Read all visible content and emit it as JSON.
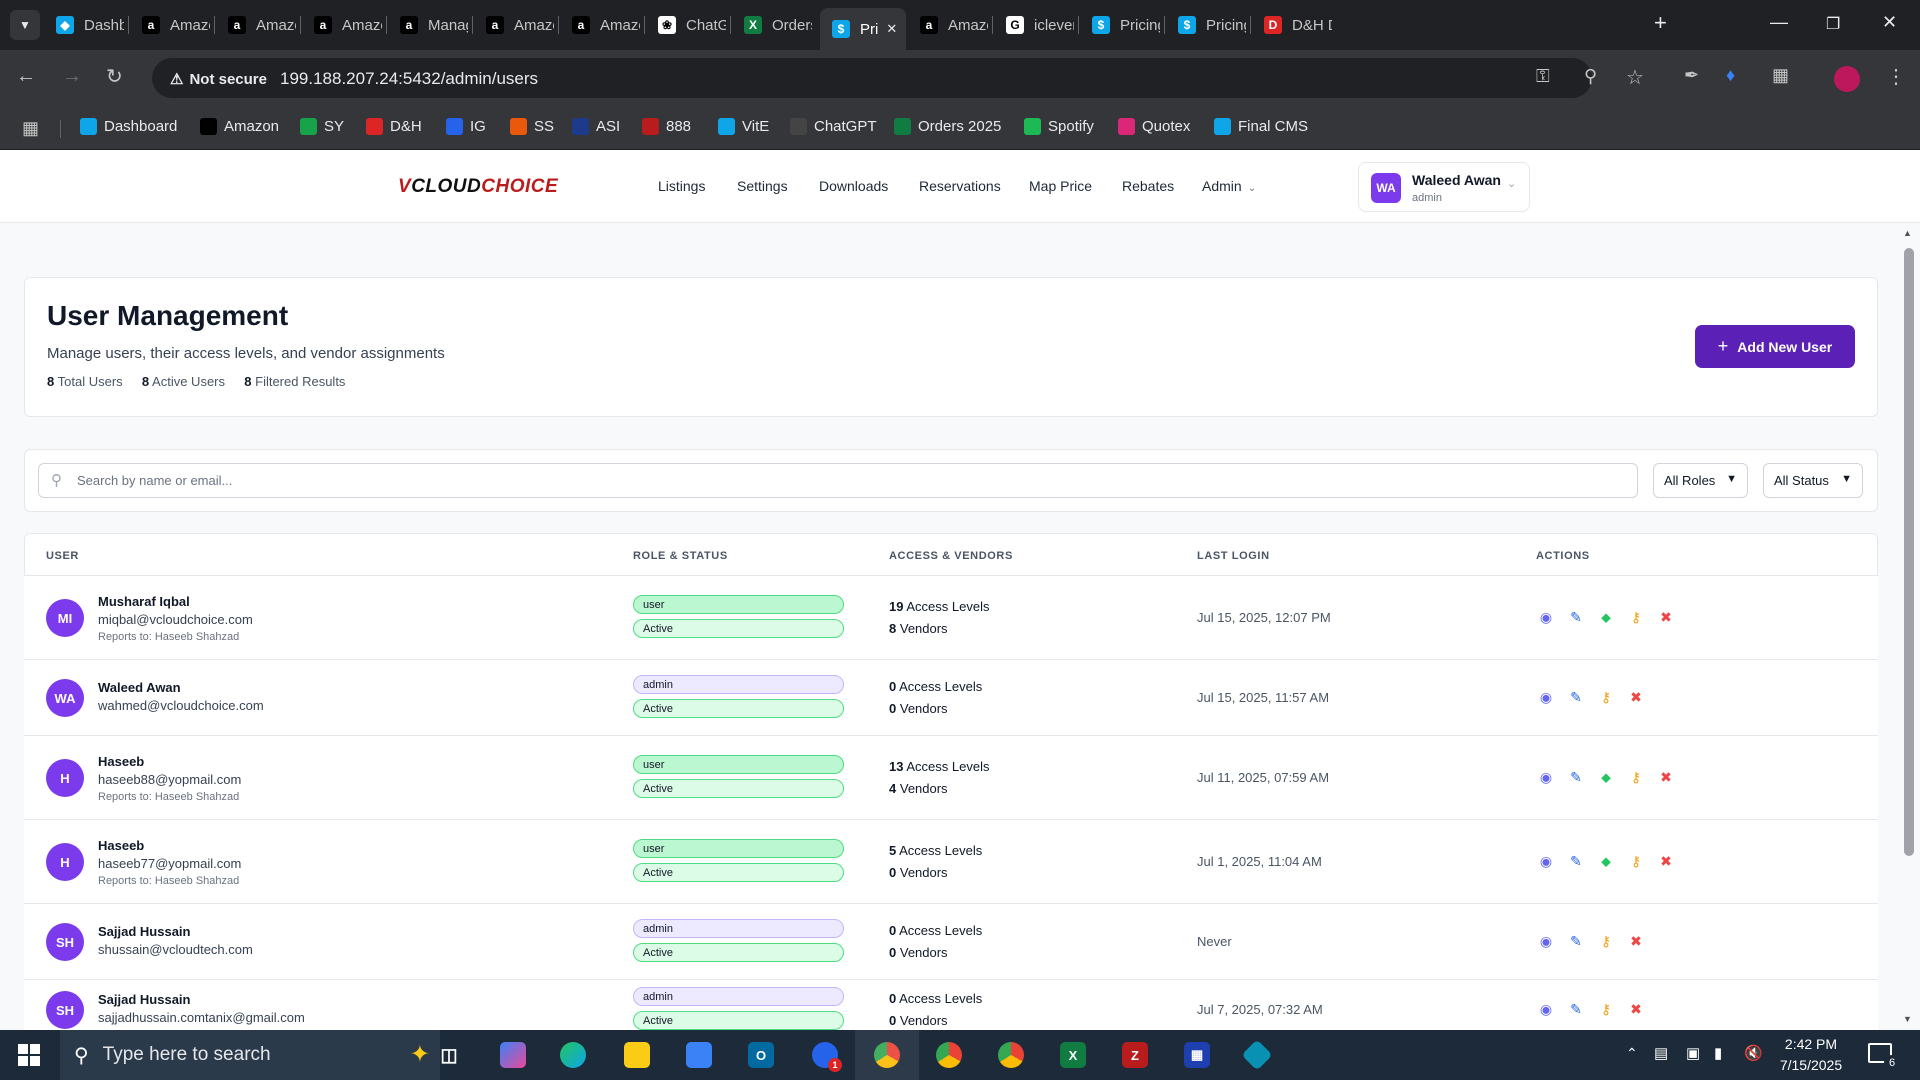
{
  "browser": {
    "tabs": [
      {
        "title": "Dashbo",
        "icon": "dashboard-icon",
        "color": "#0ea5e9"
      },
      {
        "title": "Amazon",
        "icon": "amazon-icon",
        "color": "#000000"
      },
      {
        "title": "Amazon",
        "icon": "amazon-icon",
        "color": "#000000"
      },
      {
        "title": "Amazon",
        "icon": "amazon-icon",
        "color": "#000000"
      },
      {
        "title": "Manag",
        "icon": "amazon-icon",
        "color": "#000000"
      },
      {
        "title": "Amazon",
        "icon": "amazon-icon",
        "color": "#000000"
      },
      {
        "title": "Amazon",
        "icon": "amazon-icon",
        "color": "#000000"
      },
      {
        "title": "ChatGPT",
        "icon": "chatgpt-icon",
        "color": "#ffffff"
      },
      {
        "title": "Orders",
        "icon": "excel-icon",
        "color": "#107c41"
      },
      {
        "title": "Pri",
        "icon": "dollar-icon",
        "color": "#0ea5e9",
        "active": true
      },
      {
        "title": "Amazon",
        "icon": "amazon-icon",
        "color": "#000000"
      },
      {
        "title": "iclever",
        "icon": "google-icon",
        "color": "#ffffff"
      },
      {
        "title": "Pricing",
        "icon": "dollar-icon",
        "color": "#0ea5e9"
      },
      {
        "title": "Pricing",
        "icon": "dollar-icon",
        "color": "#0ea5e9"
      },
      {
        "title": "D&H D",
        "icon": "dh-icon",
        "color": "#dc2626"
      }
    ],
    "not_secure": "Not secure",
    "url": "199.188.207.24:5432/admin/users",
    "bookmarks": [
      {
        "label": "Dashboard",
        "color": "#0ea5e9"
      },
      {
        "label": "Amazon",
        "color": "#000000"
      },
      {
        "label": "SY",
        "color": "#16a34a"
      },
      {
        "label": "D&H",
        "color": "#dc2626"
      },
      {
        "label": "IG",
        "color": "#2563eb"
      },
      {
        "label": "SS",
        "color": "#ea580c"
      },
      {
        "label": "ASI",
        "color": "#1e3a8a"
      },
      {
        "label": "888",
        "color": "#b91c1c"
      },
      {
        "label": "VitE",
        "color": "#0ea5e9"
      },
      {
        "label": "ChatGPT",
        "color": "#444444"
      },
      {
        "label": "Orders 2025",
        "color": "#107c41"
      },
      {
        "label": "Spotify",
        "color": "#1db954"
      },
      {
        "label": "Quotex",
        "color": "#db2777"
      },
      {
        "label": "Final CMS",
        "color": "#0ea5e9"
      }
    ]
  },
  "nav": {
    "logo": "VCLOUDCHOICE",
    "links": [
      "Listings",
      "Settings",
      "Downloads",
      "Reservations",
      "Map Price",
      "Rebates",
      "Admin"
    ],
    "user_initials": "WA",
    "user_name": "Waleed Awan",
    "user_role": "admin"
  },
  "header": {
    "title": "User Management",
    "subtitle": "Manage users, their access levels, and vendor assignments",
    "total_users_count": "8",
    "total_users_label": "Total Users",
    "active_users_count": "8",
    "active_users_label": "Active Users",
    "filtered_count": "8",
    "filtered_label": "Filtered Results",
    "add_button": "Add New User"
  },
  "filters": {
    "search_placeholder": "Search by name or email...",
    "roles": "All Roles",
    "status": "All Status"
  },
  "table": {
    "columns": [
      "USER",
      "ROLE & STATUS",
      "ACCESS & VENDORS",
      "LAST LOGIN",
      "ACTIONS"
    ],
    "rows": [
      {
        "initials": "MI",
        "name": "Musharaf Iqbal",
        "email": "miqbal@vcloudchoice.com",
        "reports": "Reports to: Haseeb Shahzad",
        "role": "user",
        "status": "Active",
        "access_count": "19",
        "access_label": "Access Levels",
        "vendor_count": "8",
        "vendor_label": "Vendors",
        "last_login": "Jul 15, 2025, 12:07 PM",
        "has_tag": true
      },
      {
        "initials": "WA",
        "name": "Waleed Awan",
        "email": "wahmed@vcloudchoice.com",
        "reports": "",
        "role": "admin",
        "status": "Active",
        "access_count": "0",
        "access_label": "Access Levels",
        "vendor_count": "0",
        "vendor_label": "Vendors",
        "last_login": "Jul 15, 2025, 11:57 AM",
        "has_tag": false
      },
      {
        "initials": "H",
        "name": "Haseeb",
        "email": "haseeb88@yopmail.com",
        "reports": "Reports to: Haseeb Shahzad",
        "role": "user",
        "status": "Active",
        "access_count": "13",
        "access_label": "Access Levels",
        "vendor_count": "4",
        "vendor_label": "Vendors",
        "last_login": "Jul 11, 2025, 07:59 AM",
        "has_tag": true
      },
      {
        "initials": "H",
        "name": "Haseeb",
        "email": "haseeb77@yopmail.com",
        "reports": "Reports to: Haseeb Shahzad",
        "role": "user",
        "status": "Active",
        "access_count": "5",
        "access_label": "Access Levels",
        "vendor_count": "0",
        "vendor_label": "Vendors",
        "last_login": "Jul 1, 2025, 11:04 AM",
        "has_tag": true
      },
      {
        "initials": "SH",
        "name": "Sajjad Hussain",
        "email": "shussain@vcloudtech.com",
        "reports": "",
        "role": "admin",
        "status": "Active",
        "access_count": "0",
        "access_label": "Access Levels",
        "vendor_count": "0",
        "vendor_label": "Vendors",
        "last_login": "Never",
        "has_tag": false
      },
      {
        "initials": "SH",
        "name": "Sajjad Hussain",
        "email": "sajjadhussain.comtanix@gmail.com",
        "reports": "",
        "role": "admin",
        "status": "Active",
        "access_count": "0",
        "access_label": "Access Levels",
        "vendor_count": "0",
        "vendor_label": "Vendors",
        "last_login": "Jul 7, 2025, 07:32 AM",
        "has_tag": false
      }
    ]
  },
  "taskbar": {
    "search_placeholder": "Type here to search",
    "time": "2:42 PM",
    "date": "7/15/2025",
    "notification_count": "6",
    "outlook_badge": "1"
  },
  "colors": {
    "primary": "#5b21b6",
    "avatar": "#7c3aed",
    "view_icon": "#6366f1",
    "edit_icon": "#2563eb",
    "tag_icon": "#22c55e",
    "key_icon": "#f59e0b",
    "delete_icon": "#ef4444"
  }
}
